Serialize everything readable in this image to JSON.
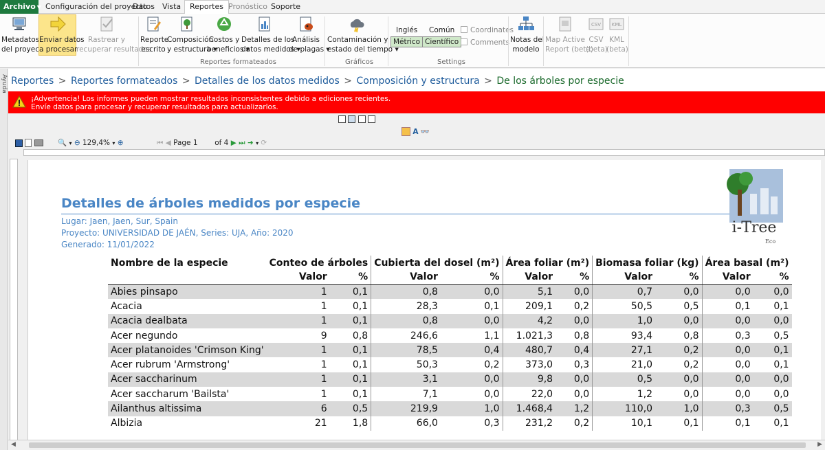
{
  "menu": {
    "file": "Archivo",
    "tabs": [
      "Configuración del proyecto",
      "Datos",
      "Vista",
      "Reportes",
      "Pronóstico",
      "Soporte"
    ]
  },
  "ribbon": {
    "metadata": [
      "Metadatos",
      "del proyecto"
    ],
    "send": [
      "Enviar datos",
      "a procesar"
    ],
    "retrieve": [
      "Rastrear y",
      "recuperar resultados"
    ],
    "written": [
      "Reporte",
      "escrito"
    ],
    "composition": [
      "Composición",
      "y estructura"
    ],
    "costs": [
      "Costos y",
      "beneficios"
    ],
    "measured": [
      "Detalles de los",
      "datos medidos"
    ],
    "pests": [
      "Análisis",
      "de plagas"
    ],
    "pollution": [
      "Contaminación y",
      "estado del tiempo"
    ],
    "english": "Inglés",
    "metric": "Métrico",
    "common": "Común",
    "scientific": "Científico",
    "coordinates": "Coordinates",
    "comments": "Comments",
    "model_notes": [
      "Notas del",
      "modelo"
    ],
    "map_active": [
      "Map Active",
      "Report (beta)"
    ],
    "csv": [
      "CSV",
      "(beta)"
    ],
    "kml": [
      "KML",
      "(beta)"
    ],
    "csv_icon": "CSV",
    "kml_icon": "KML",
    "groups": [
      "Reportes formateados",
      "Gráficos",
      "Settings"
    ]
  },
  "help_label": "Ayuda",
  "breadcrumb": {
    "items": [
      "Reportes",
      "Reportes formateados",
      "Detalles de los datos medidos",
      "Composición y estructura"
    ],
    "current": "De los árboles por especie",
    "separator": ">"
  },
  "warning": {
    "line1": "¡Advertencia! Los informes pueden mostrar resultados inconsistentes debido a ediciones recientes.",
    "line2": "Envíe datos para procesar y recuperar resultados para actualizarlos."
  },
  "viewer": {
    "zoom": "129,4%",
    "page_label": "Page",
    "page_value": "1",
    "page_of": "of 4"
  },
  "report": {
    "title": "Detalles de árboles medidos por especie",
    "location": "Lugar: Jaen, Jaen, Sur, Spain",
    "project": "Proyecto: UNIVERSIDAD DE JAÉN, Series: UJA, Año: 2020",
    "generated": "Generado: 11/01/2022",
    "logo_text": "i-Tree",
    "logo_sub": "Eco"
  },
  "table": {
    "headers": [
      "Nombre de la especie",
      "Conteo de árboles",
      "Cubierta del dosel (m²)",
      "Área foliar (m²)",
      "Biomasa foliar (kg)",
      "Área basal (m²)"
    ],
    "sub": [
      "Valor",
      "%"
    ],
    "rows": [
      [
        "Abies pinsapo",
        "1",
        "0,1",
        "0,8",
        "0,0",
        "5,1",
        "0,0",
        "0,7",
        "0,0",
        "0,0",
        "0,0"
      ],
      [
        "Acacia",
        "1",
        "0,1",
        "28,3",
        "0,1",
        "209,1",
        "0,2",
        "50,5",
        "0,5",
        "0,1",
        "0,1"
      ],
      [
        "Acacia dealbata",
        "1",
        "0,1",
        "0,8",
        "0,0",
        "4,2",
        "0,0",
        "1,0",
        "0,0",
        "0,0",
        "0,0"
      ],
      [
        "Acer negundo",
        "9",
        "0,8",
        "246,6",
        "1,1",
        "1.021,3",
        "0,8",
        "93,4",
        "0,8",
        "0,3",
        "0,5"
      ],
      [
        "Acer platanoides 'Crimson King'",
        "1",
        "0,1",
        "78,5",
        "0,4",
        "480,7",
        "0,4",
        "27,1",
        "0,2",
        "0,0",
        "0,1"
      ],
      [
        "Acer rubrum 'Armstrong'",
        "1",
        "0,1",
        "50,3",
        "0,2",
        "373,0",
        "0,3",
        "21,0",
        "0,2",
        "0,0",
        "0,1"
      ],
      [
        "Acer saccharinum",
        "1",
        "0,1",
        "3,1",
        "0,0",
        "9,8",
        "0,0",
        "0,5",
        "0,0",
        "0,0",
        "0,0"
      ],
      [
        "Acer saccharum 'Bailsta'",
        "1",
        "0,1",
        "7,1",
        "0,0",
        "22,0",
        "0,0",
        "1,2",
        "0,0",
        "0,0",
        "0,0"
      ],
      [
        "Ailanthus altissima",
        "6",
        "0,5",
        "219,9",
        "1,0",
        "1.468,4",
        "1,2",
        "110,0",
        "1,0",
        "0,3",
        "0,5"
      ],
      [
        "Albizia",
        "21",
        "1,8",
        "66,0",
        "0,3",
        "231,2",
        "0,2",
        "10,1",
        "0,1",
        "0,1",
        "0,1"
      ]
    ]
  },
  "colors": {
    "file_tab": "#1e7a3e",
    "warning_bg": "#ff0000",
    "title": "#4a86c5",
    "row_shade": "#d9d9d9"
  }
}
